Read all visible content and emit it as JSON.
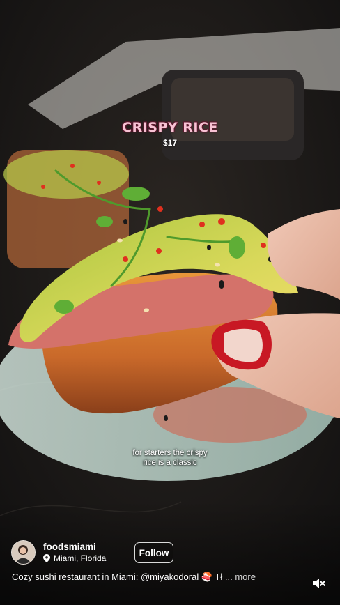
{
  "overlay": {
    "title": "CRISPY RICE",
    "price": "$17"
  },
  "caption": {
    "line1": "for starters the crispy",
    "line2": "rice is a classic"
  },
  "profile": {
    "username": "foodsmiami",
    "location": "Miami, Florida",
    "avatar_icon": "avatar-photo",
    "location_icon": "location-pin-icon"
  },
  "follow_button": {
    "label": "Follow"
  },
  "description": {
    "text": "Cozy sushi restaurant in Miami: @miyakodoral 🍣 Tł",
    "ellipsis": "...",
    "more_label": "more"
  },
  "controls": {
    "mute_icon": "muted-speaker-icon"
  },
  "colors": {
    "title_pink": "#f8c2d4",
    "title_outline": "#5b1a2e",
    "background_dark": "#1a1816"
  }
}
